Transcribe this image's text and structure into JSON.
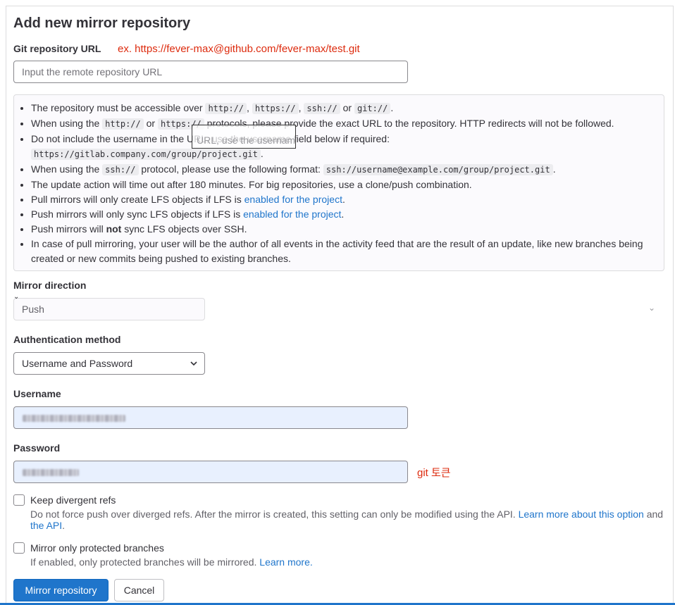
{
  "page": {
    "title": "Add new mirror repository"
  },
  "git_url": {
    "label": "Git repository URL",
    "annotation": "ex. https://fever-max@github.com/fever-max/test.git",
    "placeholder": "Input the remote repository URL"
  },
  "info": {
    "item1": {
      "pre": "The repository must be accessible over ",
      "c1": "http://",
      "s1": ", ",
      "c2": "https://",
      "s2": ", ",
      "c3": "ssh://",
      "s3": " or ",
      "c4": "git://",
      "end": "."
    },
    "item2": {
      "pre": "When using the ",
      "c1": "http://",
      "mid": " or ",
      "c2": "https://",
      "end": " protocols, please provide the exact URL to the repository. HTTP redirects will not be followed."
    },
    "item3": {
      "pre": "Do not include the username in the URL, use the username field below if required:",
      "code": "https://gitlab.company.com/group/project.git",
      "end": "."
    },
    "item4": {
      "pre": "When using the ",
      "c1": "ssh://",
      "mid": " protocol, please use the following format: ",
      "c2": "ssh://username@example.com/group/project.git",
      "end": "."
    },
    "item5": "The update action will time out after 180 minutes. For big repositories, use a clone/push combination.",
    "item6": {
      "pre": "Pull mirrors will only create LFS objects if LFS is ",
      "link": "enabled for the project",
      "end": "."
    },
    "item7": {
      "pre": "Push mirrors will only sync LFS objects if LFS is ",
      "link": "enabled for the project",
      "end": "."
    },
    "item8": {
      "pre": "Push mirrors will ",
      "bold": "not",
      "end": " sync LFS objects over SSH."
    },
    "item9": "In case of pull mirroring, your user will be the author of all events in the activity feed that are the result of an update, like new branches being created or new commits being pushed to existing branches.",
    "overlay_text": "URL, use the username"
  },
  "mirror_direction": {
    "label": "Mirror direction",
    "value": "Push"
  },
  "auth_method": {
    "label": "Authentication method",
    "value": "Username and Password"
  },
  "username": {
    "label": "Username"
  },
  "password": {
    "label": "Password",
    "annotation": "git 토큰"
  },
  "keep_divergent": {
    "label": "Keep divergent refs",
    "help_pre": "Do not force push over diverged refs. After the mirror is created, this setting can only be modified using the API. ",
    "help_link1": "Learn more about this option",
    "help_and": " and ",
    "help_link2": "the API",
    "help_end": "."
  },
  "protected_only": {
    "label": "Mirror only protected branches",
    "help_pre": "If enabled, only protected branches will be mirrored. ",
    "help_link": "Learn more."
  },
  "buttons": {
    "submit": "Mirror repository",
    "cancel": "Cancel"
  },
  "colors": {
    "primary": "#1f75cb",
    "annotation": "#dd2b0e",
    "autofill": "#e8f0fe"
  },
  "icons": {
    "select_chevron": "chevron-down-icon"
  }
}
